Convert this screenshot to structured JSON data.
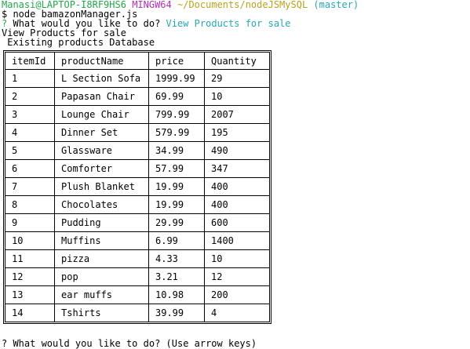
{
  "prompt": {
    "user_host": "Manasi@LAPTOP-I8RF9HS6",
    "system": "MINGW64",
    "path": "~/Documents/nodeJSMySQL",
    "branch": "(master)"
  },
  "command": "$ node bamazonManager.js",
  "question": {
    "mark": "?",
    "text": "What would you like to do?",
    "answer": "View Products for sale"
  },
  "output_lines": [
    "View Products for sale",
    " Existing products Database"
  ],
  "table": {
    "headers": [
      "itemId",
      "productName",
      "price",
      "Quantity"
    ],
    "rows": [
      [
        "1",
        "L Section Sofa",
        "1999.99",
        "29"
      ],
      [
        "2",
        "Papasan Chair",
        "69.99",
        "10"
      ],
      [
        "3",
        "Lounge Chair",
        "799.99",
        "2007"
      ],
      [
        "4",
        "Dinner Set",
        "579.99",
        "195"
      ],
      [
        "5",
        "Glassware",
        "34.99",
        "490"
      ],
      [
        "6",
        "Comforter",
        "57.99",
        "347"
      ],
      [
        "7",
        "Plush Blanket",
        "19.99",
        "400"
      ],
      [
        "8",
        "Chocolates",
        "19.99",
        "400"
      ],
      [
        "9",
        "Pudding",
        "29.99",
        "600"
      ],
      [
        "10",
        "Muffins",
        "6.99",
        "1400"
      ],
      [
        "11",
        "pizza",
        "4.33",
        "10"
      ],
      [
        "12",
        "pop",
        "3.21",
        "12"
      ],
      [
        "13",
        "ear muffs",
        "10.98",
        "200"
      ],
      [
        "14",
        "Tshirts",
        "39.99",
        "4"
      ]
    ]
  },
  "next_prompt_cut": "? What would you like to do? (Use arrow keys)"
}
